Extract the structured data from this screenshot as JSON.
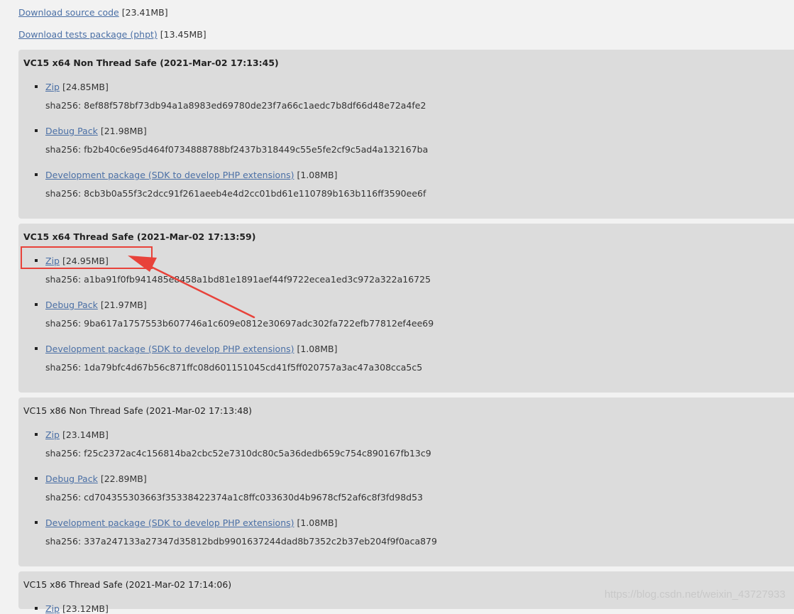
{
  "top_links": [
    {
      "label": "Download source code",
      "size": "[23.41MB]"
    },
    {
      "label": "Download tests package (phpt)",
      "size": "[13.45MB]"
    }
  ],
  "panels": [
    {
      "title": "VC15 x64 Non Thread Safe (2021-Mar-02 17:13:45)",
      "bold": true,
      "items": [
        {
          "label": "Zip",
          "size": "[24.85MB]",
          "sha": "sha256: 8ef88f578bf73db94a1a8983ed69780de23f7a66c1aedc7b8df66d48e72a4fe2"
        },
        {
          "label": "Debug Pack",
          "size": "[21.98MB]",
          "sha": "sha256: fb2b40c6e95d464f0734888788bf2437b318449c55e5fe2cf9c5ad4a132167ba"
        },
        {
          "label": "Development package (SDK to develop PHP extensions)",
          "size": "[1.08MB]",
          "sha": "sha256: 8cb3b0a55f3c2dcc91f261aeeb4e4d2cc01bd61e110789b163b116ff3590ee6f"
        }
      ]
    },
    {
      "title": "VC15 x64 Thread Safe (2021-Mar-02 17:13:59)",
      "bold": true,
      "items": [
        {
          "label": "Zip",
          "size": "[24.95MB]",
          "sha": "sha256: a1ba91f0fb941485e8458a1bd81e1891aef44f9722ecea1ed3c972a322a16725"
        },
        {
          "label": "Debug Pack",
          "size": "[21.97MB]",
          "sha": "sha256: 9ba617a1757553b607746a1c609e0812e30697adc302fa722efb77812ef4ee69"
        },
        {
          "label": "Development package (SDK to develop PHP extensions)",
          "size": "[1.08MB]",
          "sha": "sha256: 1da79bfc4d67b56c871ffc08d601151045cd41f5ff020757a3ac47a308cca5c5"
        }
      ]
    },
    {
      "title": "VC15 x86 Non Thread Safe (2021-Mar-02 17:13:48)",
      "bold": false,
      "items": [
        {
          "label": "Zip",
          "size": "[23.14MB]",
          "sha": "sha256: f25c2372ac4c156814ba2cbc52e7310dc80c5a36dedb659c754c890167fb13c9"
        },
        {
          "label": "Debug Pack",
          "size": "[22.89MB]",
          "sha": "sha256: cd704355303663f35338422374a1c8ffc033630d4b9678cf52af6c8f3fd98d53"
        },
        {
          "label": "Development package (SDK to develop PHP extensions)",
          "size": "[1.08MB]",
          "sha": "sha256: 337a247133a27347d35812bdb9901637244dad8b7352c2b37eb204f9f0aca879"
        }
      ]
    },
    {
      "title": "VC15 x86 Thread Safe (2021-Mar-02 17:14:06)",
      "bold": false,
      "items": [
        {
          "label": "Zip",
          "size": "[23.12MB]"
        }
      ]
    }
  ],
  "watermark": "https://blog.csdn.net/weixin_43727933",
  "annotation_color": "#e8423a"
}
